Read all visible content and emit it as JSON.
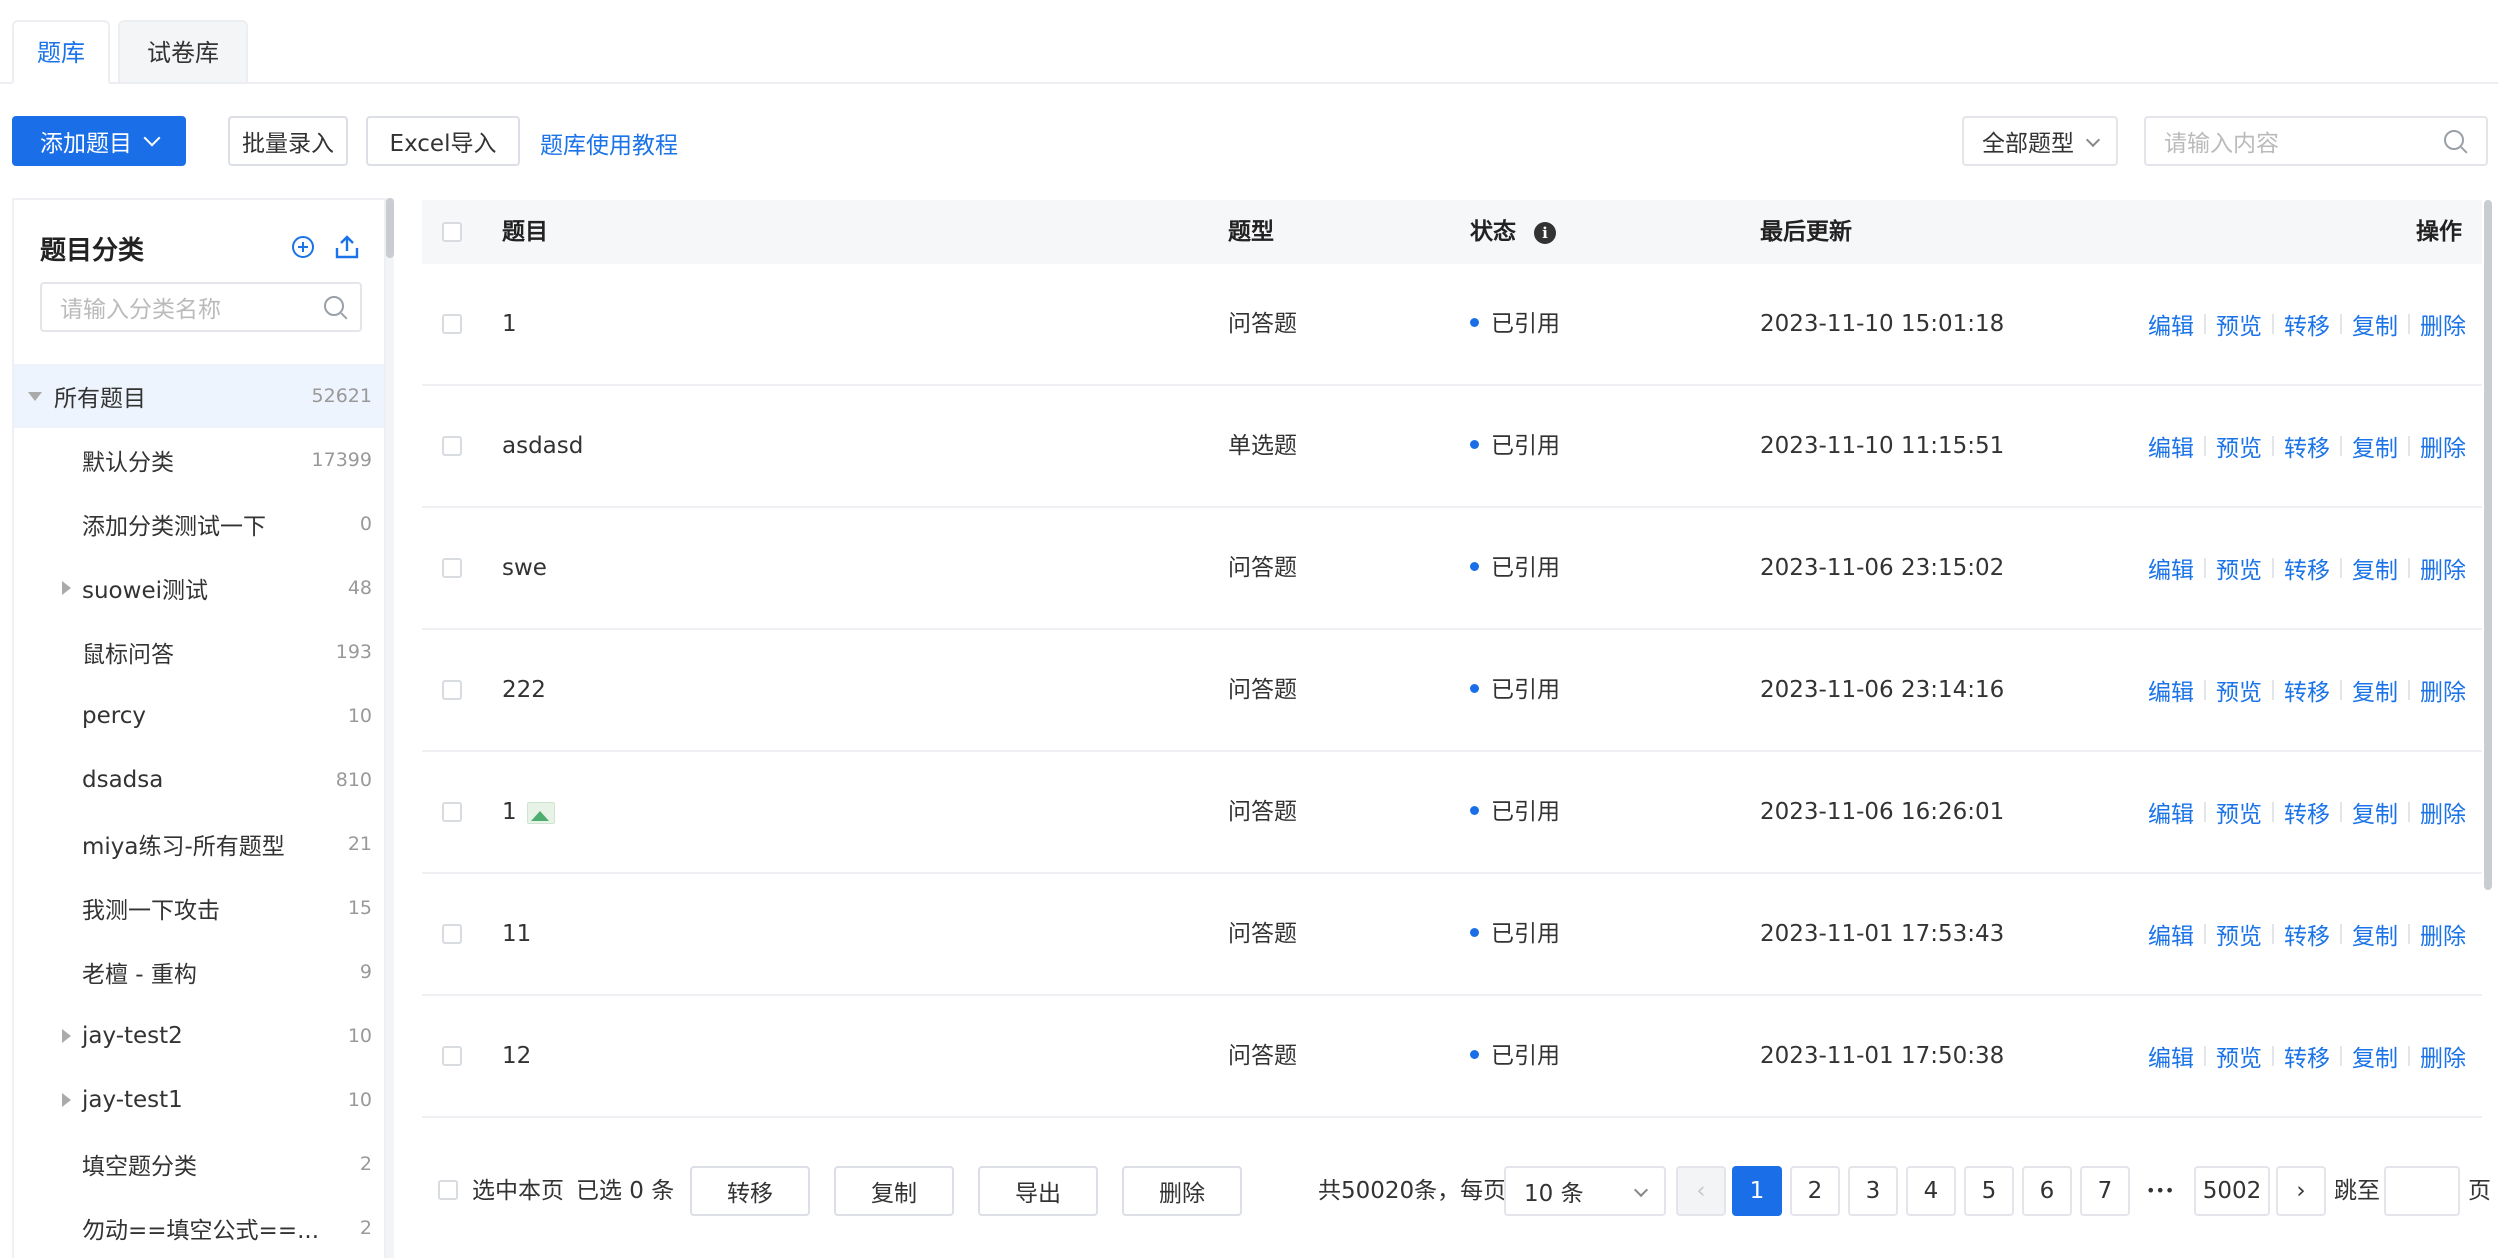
{
  "tabs": [
    "题库",
    "试卷库"
  ],
  "toolbar": {
    "add_label": "添加题目",
    "batch_label": "批量录入",
    "excel_label": "Excel导入",
    "tutorial_label": "题库使用教程",
    "type_filter": "全部题型",
    "search_placeholder": "请输入内容"
  },
  "sidebar": {
    "title": "题目分类",
    "search_placeholder": "请输入分类名称",
    "items": [
      {
        "label": "所有题目",
        "count": "52621"
      },
      {
        "label": "默认分类",
        "count": "17399"
      },
      {
        "label": "添加分类测试一下",
        "count": "0"
      },
      {
        "label": "suowei测试",
        "count": "48"
      },
      {
        "label": "鼠标问答",
        "count": "193"
      },
      {
        "label": "percy",
        "count": "10"
      },
      {
        "label": "dsadsa",
        "count": "810"
      },
      {
        "label": "miya练习-所有题型",
        "count": "21"
      },
      {
        "label": "我测一下攻击",
        "count": "15"
      },
      {
        "label": "老檀 - 重构",
        "count": "9"
      },
      {
        "label": "jay-test2",
        "count": "10"
      },
      {
        "label": "jay-test1",
        "count": "10"
      },
      {
        "label": "填空题分类",
        "count": "2"
      },
      {
        "label": "勿动==填空公式==...",
        "count": "2"
      }
    ]
  },
  "table": {
    "headers": {
      "title": "题目",
      "type": "题型",
      "status": "状态",
      "updated": "最后更新",
      "actions": "操作"
    },
    "actions": [
      "编辑",
      "预览",
      "转移",
      "复制",
      "删除"
    ],
    "rows": [
      {
        "title": "1",
        "type": "问答题",
        "status": "已引用",
        "updated": "2023-11-10 15:01:18"
      },
      {
        "title": "asdasd",
        "type": "单选题",
        "status": "已引用",
        "updated": "2023-11-10 11:15:51"
      },
      {
        "title": "swe",
        "type": "问答题",
        "status": "已引用",
        "updated": "2023-11-06 23:15:02"
      },
      {
        "title": "222",
        "type": "问答题",
        "status": "已引用",
        "updated": "2023-11-06 23:14:16"
      },
      {
        "title": "1",
        "type": "问答题",
        "status": "已引用",
        "updated": "2023-11-06 16:26:01"
      },
      {
        "title": "11",
        "type": "问答题",
        "status": "已引用",
        "updated": "2023-11-01 17:53:43"
      },
      {
        "title": "12",
        "type": "问答题",
        "status": "已引用",
        "updated": "2023-11-01 17:50:38"
      }
    ]
  },
  "footer": {
    "select_page": "选中本页",
    "selected": "已选 0 条",
    "transfer": "转移",
    "copy": "复制",
    "export": "导出",
    "delete": "删除",
    "total": "共50020条，每页",
    "page_size": "10 条",
    "pages": [
      "1",
      "2",
      "3",
      "4",
      "5",
      "6",
      "7"
    ],
    "ellipsis": "•••",
    "last_page": "5002",
    "jump_label": "跳至",
    "page_unit": "页"
  },
  "colors": {
    "primary": "#1a6fe8",
    "link": "#1a73e8"
  }
}
